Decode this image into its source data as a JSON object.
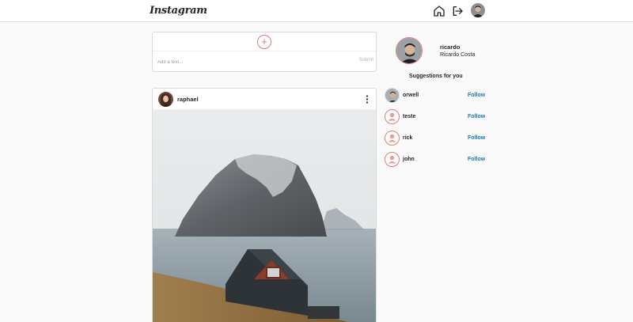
{
  "app": {
    "logo": "Instagram"
  },
  "nav": {
    "icons": [
      "home-icon",
      "logout-icon",
      "avatar"
    ]
  },
  "composer": {
    "placeholder": "Add a text...",
    "submit_label": "Submit",
    "add_icon": "plus-icon"
  },
  "post": {
    "username": "raphael",
    "menu_icon": "more-vertical-icon"
  },
  "profile": {
    "username": "ricardo",
    "full_name": "Ricardo Costa"
  },
  "suggestions": {
    "title": "Suggestions for you",
    "items": [
      {
        "username": "orwell",
        "follow_label": "Follow"
      },
      {
        "username": "teste",
        "follow_label": "Follow"
      },
      {
        "username": "rick",
        "follow_label": "Follow"
      },
      {
        "username": "john",
        "follow_label": "Follow"
      }
    ]
  },
  "colors": {
    "accent": "#e5787a",
    "link": "#1a79b8",
    "border": "#dbdbdb",
    "background": "#fafafa"
  }
}
